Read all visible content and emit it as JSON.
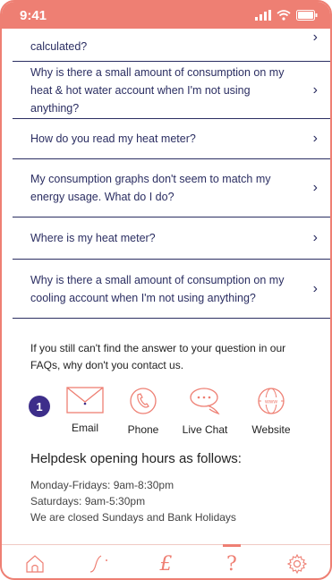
{
  "status_bar": {
    "time": "9:41"
  },
  "faq": {
    "partial_item": "calculated?",
    "items": [
      "Why is there a small amount of consumption on my heat & hot water account when I'm not using anything?",
      "How do you read my heat meter?",
      "My consumption graphs don't seem to match my energy usage. What do I do?",
      "Where is my heat meter?",
      "Why is there a small amount of consumption on my cooling account when I'm not using anything?"
    ]
  },
  "contact": {
    "intro": "If you still can't find the answer to your question in our FAQs, why don't you contact us.",
    "badge": "1",
    "options": [
      "Email",
      "Phone",
      "Live Chat",
      "Website"
    ],
    "icon_names": [
      "envelope-icon",
      "phone-icon",
      "chat-bubble-icon",
      "www-globe-icon"
    ]
  },
  "helpdesk": {
    "title": "Helpdesk opening hours as follows:",
    "lines": [
      "Monday-Fridays: 9am-8:30pm",
      "Saturdays: 9am-5:30pm",
      "We are closed Sundays and Bank Holidays"
    ]
  },
  "tabs": {
    "icons": [
      "home-icon",
      "graph-icon",
      "pound-icon",
      "question-icon",
      "settings-icon"
    ],
    "active": "question-icon"
  },
  "colors": {
    "accent": "#ee7f73",
    "navy": "#2b2e62",
    "badge": "#3d2e8a"
  }
}
